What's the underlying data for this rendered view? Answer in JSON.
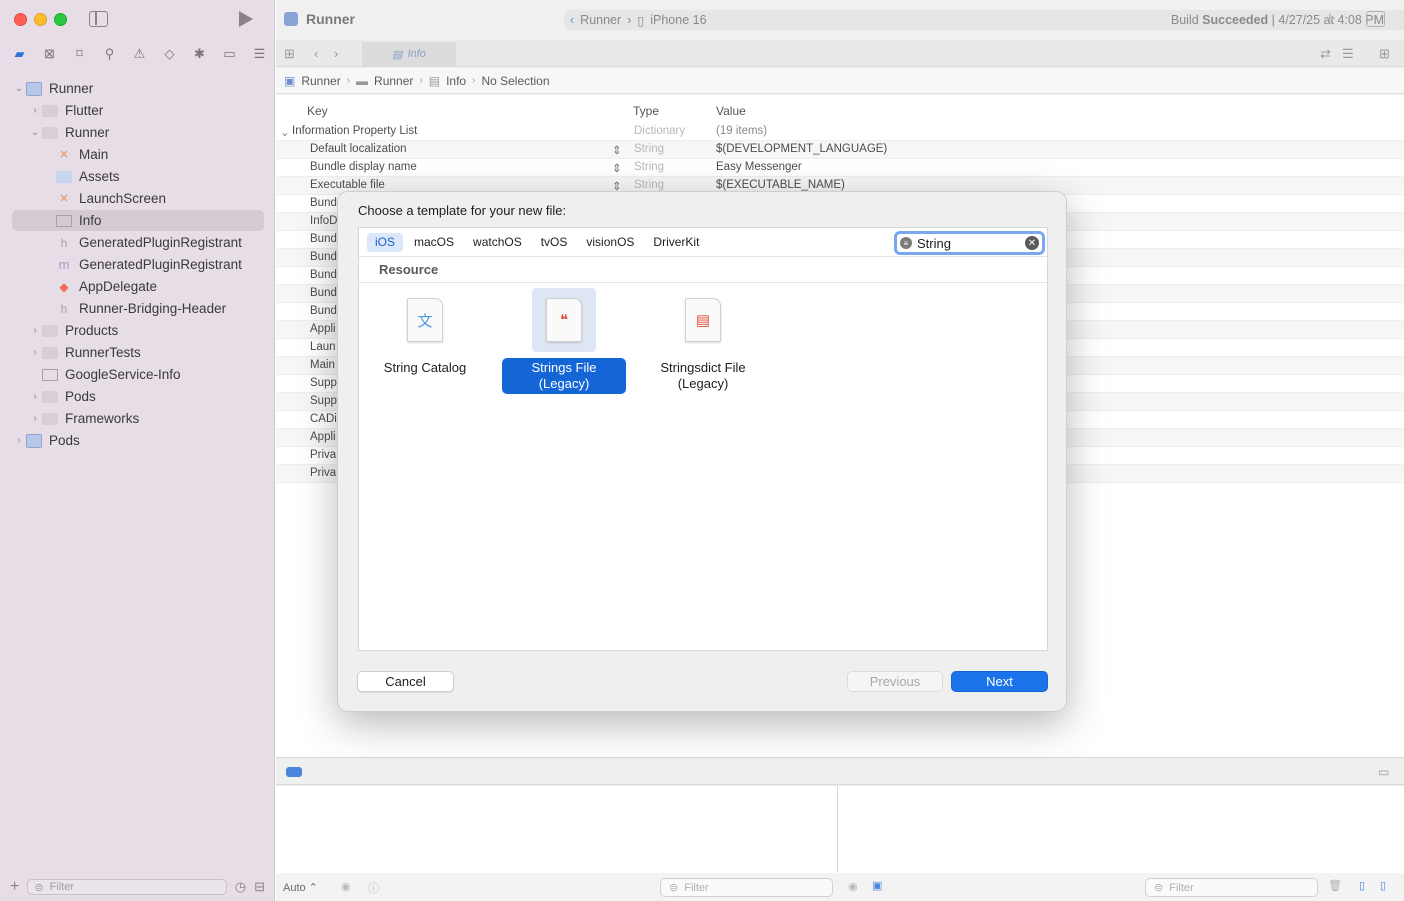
{
  "toolbar": {
    "project": "Runner",
    "scheme_project": "Runner",
    "device": "iPhone 16",
    "build_status_prefix": "Build ",
    "build_status_bold": "Succeeded",
    "build_status_suffix": " | 4/27/25 at 4:08 PM"
  },
  "tab": {
    "label": "Info"
  },
  "breadcrumb": [
    "Runner",
    "Runner",
    "Info",
    "No Selection"
  ],
  "sidebar": {
    "items": [
      {
        "label": "Runner",
        "icon": "project-icon"
      },
      {
        "label": "Flutter",
        "icon": "folder-icon"
      },
      {
        "label": "Runner",
        "icon": "folder-icon"
      },
      {
        "label": "Main",
        "icon": "storyboard-icon"
      },
      {
        "label": "Assets",
        "icon": "asset-catalog-icon"
      },
      {
        "label": "LaunchScreen",
        "icon": "storyboard-icon"
      },
      {
        "label": "Info",
        "icon": "plist-icon"
      },
      {
        "label": "GeneratedPluginRegistrant",
        "icon": "header-icon"
      },
      {
        "label": "GeneratedPluginRegistrant",
        "icon": "objc-icon"
      },
      {
        "label": "AppDelegate",
        "icon": "swift-icon"
      },
      {
        "label": "Runner-Bridging-Header",
        "icon": "header-icon"
      },
      {
        "label": "Products",
        "icon": "folder-icon"
      },
      {
        "label": "RunnerTests",
        "icon": "folder-icon"
      },
      {
        "label": "GoogleService-Info",
        "icon": "plist-icon"
      },
      {
        "label": "Pods",
        "icon": "folder-icon"
      },
      {
        "label": "Frameworks",
        "icon": "folder-icon"
      },
      {
        "label": "Pods",
        "icon": "project-icon"
      }
    ],
    "filter_placeholder": "Filter"
  },
  "plist": {
    "headers": {
      "key": "Key",
      "type": "Type",
      "value": "Value"
    },
    "root": {
      "key": "Information Property List",
      "type": "Dictionary",
      "value": "(19 items)"
    },
    "rows": [
      {
        "key": "Default localization",
        "type": "String",
        "value": "$(DEVELOPMENT_LANGUAGE)"
      },
      {
        "key": "Bundle display name",
        "type": "String",
        "value": "Easy Messenger"
      },
      {
        "key": "Executable file",
        "type": "String",
        "value": "$(EXECUTABLE_NAME)"
      },
      {
        "key": "Bund",
        "type": "",
        "value": ""
      },
      {
        "key": "InfoD",
        "type": "",
        "value": ""
      },
      {
        "key": "Bund",
        "type": "",
        "value": ""
      },
      {
        "key": "Bund",
        "type": "",
        "value": ""
      },
      {
        "key": "Bund",
        "type": "",
        "value": ""
      },
      {
        "key": "Bund",
        "type": "",
        "value": ""
      },
      {
        "key": "Bund",
        "type": "",
        "value": ""
      },
      {
        "key": "Appli",
        "type": "",
        "value": ""
      },
      {
        "key": "Laun",
        "type": "",
        "value": ""
      },
      {
        "key": "Main",
        "type": "",
        "value": ""
      },
      {
        "key": "Supp",
        "type": "",
        "value": ""
      },
      {
        "key": "Supp",
        "type": "",
        "value": ""
      },
      {
        "key": "CADi",
        "type": "",
        "value": ""
      },
      {
        "key": "Appli",
        "type": "",
        "value": ""
      },
      {
        "key": "Priva",
        "type": "",
        "value": ""
      },
      {
        "key": "Priva",
        "type": "",
        "value": ""
      }
    ]
  },
  "dialog": {
    "title": "Choose a template for your new file:",
    "platforms": [
      "iOS",
      "macOS",
      "watchOS",
      "tvOS",
      "visionOS",
      "DriverKit"
    ],
    "selected_platform": "iOS",
    "search_value": "String",
    "section": "Resource",
    "templates": [
      {
        "label": "String Catalog",
        "selected": false
      },
      {
        "label": "Strings File (Legacy)",
        "selected": true
      },
      {
        "label": "Stringsdict File (Legacy)",
        "selected": false
      }
    ],
    "cancel_label": "Cancel",
    "previous_label": "Previous",
    "next_label": "Next"
  },
  "bottom": {
    "auto_label": "Auto ⌃",
    "filter_placeholder": "Filter",
    "filter_placeholder_2": "Filter"
  }
}
